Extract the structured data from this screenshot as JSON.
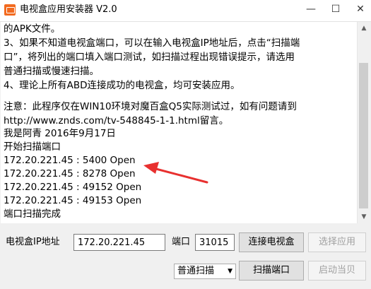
{
  "window": {
    "title": "电视盒应用安装器 V2.0",
    "minimize": "—",
    "maximize": "☐",
    "close": "✕"
  },
  "log": {
    "lines": [
      "的APK文件。",
      "3、如果不知道电视盒端口，可以在输入电视盒IP地址后，点击“扫描端",
      "口”，将列出的端口填入端口测试，如扫描过程出现错误提示，请选用",
      "普通扫描或慢速扫描。",
      "4、理论上所有ABD连接成功的电视盒，均可安装应用。",
      "",
      "注意：此程序仅在WIN10环境对魔百盒Q5实际测试过，如有问题请到",
      "http://www.znds.com/tv-548845-1-1.html留言。",
      "             我是阿青  2016年9月17日",
      "开始扫描端口",
      "172.20.221.45 : 5400 Open",
      "172.20.221.45 : 8278 Open",
      "172.20.221.45 : 49152 Open",
      "172.20.221.45 : 49153 Open",
      "端口扫描完成"
    ]
  },
  "form": {
    "ip_label": "电视盒IP地址",
    "ip_value": "172.20.221.45",
    "port_label": "端口",
    "port_value": "31015",
    "connect_button": "连接电视盒",
    "select_app_button": "选择应用",
    "scan_mode": "普通扫描",
    "scan_button": "扫描端口",
    "launch_button": "启动当贝"
  },
  "colors": {
    "annotation_arrow": "#e8302f"
  }
}
